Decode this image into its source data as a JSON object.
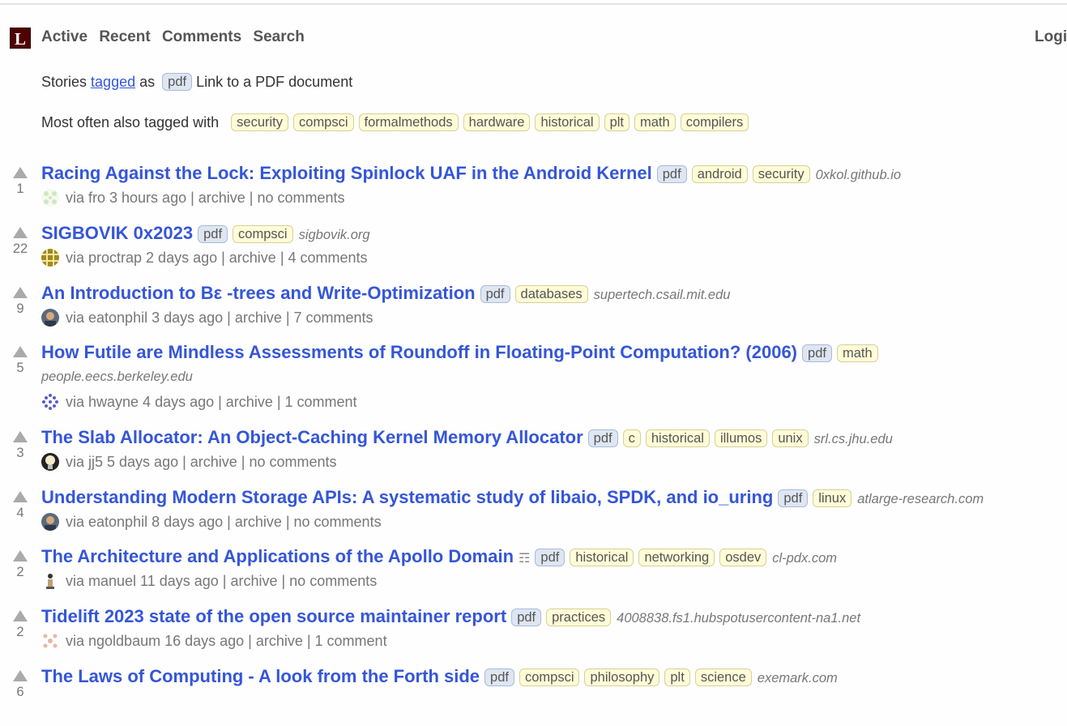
{
  "header": {
    "logo": "L",
    "nav": [
      "Active",
      "Recent",
      "Comments",
      "Search"
    ],
    "login": "Login"
  },
  "intro": {
    "prefix": "Stories",
    "link": "tagged",
    "as": "as",
    "tag": "pdf",
    "description": "Link to a PDF document",
    "also_label": "Most often also tagged with",
    "also_tags": [
      "security",
      "compsci",
      "formalmethods",
      "hardware",
      "historical",
      "plt",
      "math",
      "compilers"
    ]
  },
  "stories": [
    {
      "title": "Racing Against the Lock: Exploiting Spinlock UAF in the Android Kernel",
      "tags": [
        "pdf",
        "android",
        "security"
      ],
      "domain": "0xkol.github.io",
      "score": "1",
      "by": "via fro 3 hours ago | archive | no comments",
      "avatar": "green-pattern"
    },
    {
      "title": "SIGBOVIK 0x2023",
      "tags": [
        "pdf",
        "compsci"
      ],
      "domain": "sigbovik.org",
      "score": "22",
      "by": "via proctrap 2 days ago | archive | 4 comments",
      "avatar": "gold-grid"
    },
    {
      "title": "An Introduction to Bε -trees and Write-Optimization",
      "tags": [
        "pdf",
        "databases"
      ],
      "domain": "supertech.csail.mit.edu",
      "score": "9",
      "by": "via eatonphil 3 days ago | archive | 7 comments",
      "avatar": "photo"
    },
    {
      "title": "How Futile are Mindless Assessments of Roundoff in Floating-Point Computation? (2006)",
      "tags": [
        "pdf",
        "math"
      ],
      "domain": "people.eecs.berkeley.edu",
      "score": "5",
      "by": "via hwayne 4 days ago | archive | 1 comment",
      "avatar": "blue-pattern"
    },
    {
      "title": "The Slab Allocator: An Object-Caching Kernel Memory Allocator",
      "tags": [
        "pdf",
        "c",
        "historical",
        "illumos",
        "unix"
      ],
      "domain": "srl.cs.jhu.edu",
      "score": "3",
      "by": "via jj5 5 days ago | archive | no comments",
      "avatar": "bulb"
    },
    {
      "title": "Understanding Modern Storage APIs: A systematic study of libaio, SPDK, and io_uring",
      "tags": [
        "pdf",
        "linux"
      ],
      "domain": "atlarge-research.com",
      "score": "4",
      "by": "via eatonphil 8 days ago | archive | no comments",
      "avatar": "photo"
    },
    {
      "title": "The Architecture and Applications of the Apollo Domain",
      "glyph": "☶",
      "tags": [
        "pdf",
        "historical",
        "networking",
        "osdev"
      ],
      "domain": "cl-pdx.com",
      "score": "2",
      "by": "via manuel 11 days ago | archive | no comments",
      "avatar": "figure"
    },
    {
      "title": "Tidelift 2023 state of the open source maintainer report",
      "tags": [
        "pdf",
        "practices"
      ],
      "domain": "4008838.fs1.hubspotusercontent-na1.net",
      "score": "2",
      "by": "via ngoldbaum 16 days ago | archive | 1 comment",
      "avatar": "peach-pattern"
    },
    {
      "title": "The Laws of Computing - A look from the Forth side",
      "tags": [
        "pdf",
        "compsci",
        "philosophy",
        "plt",
        "science"
      ],
      "domain": "exemark.com",
      "score": "6",
      "by": "",
      "avatar": "photo"
    }
  ]
}
